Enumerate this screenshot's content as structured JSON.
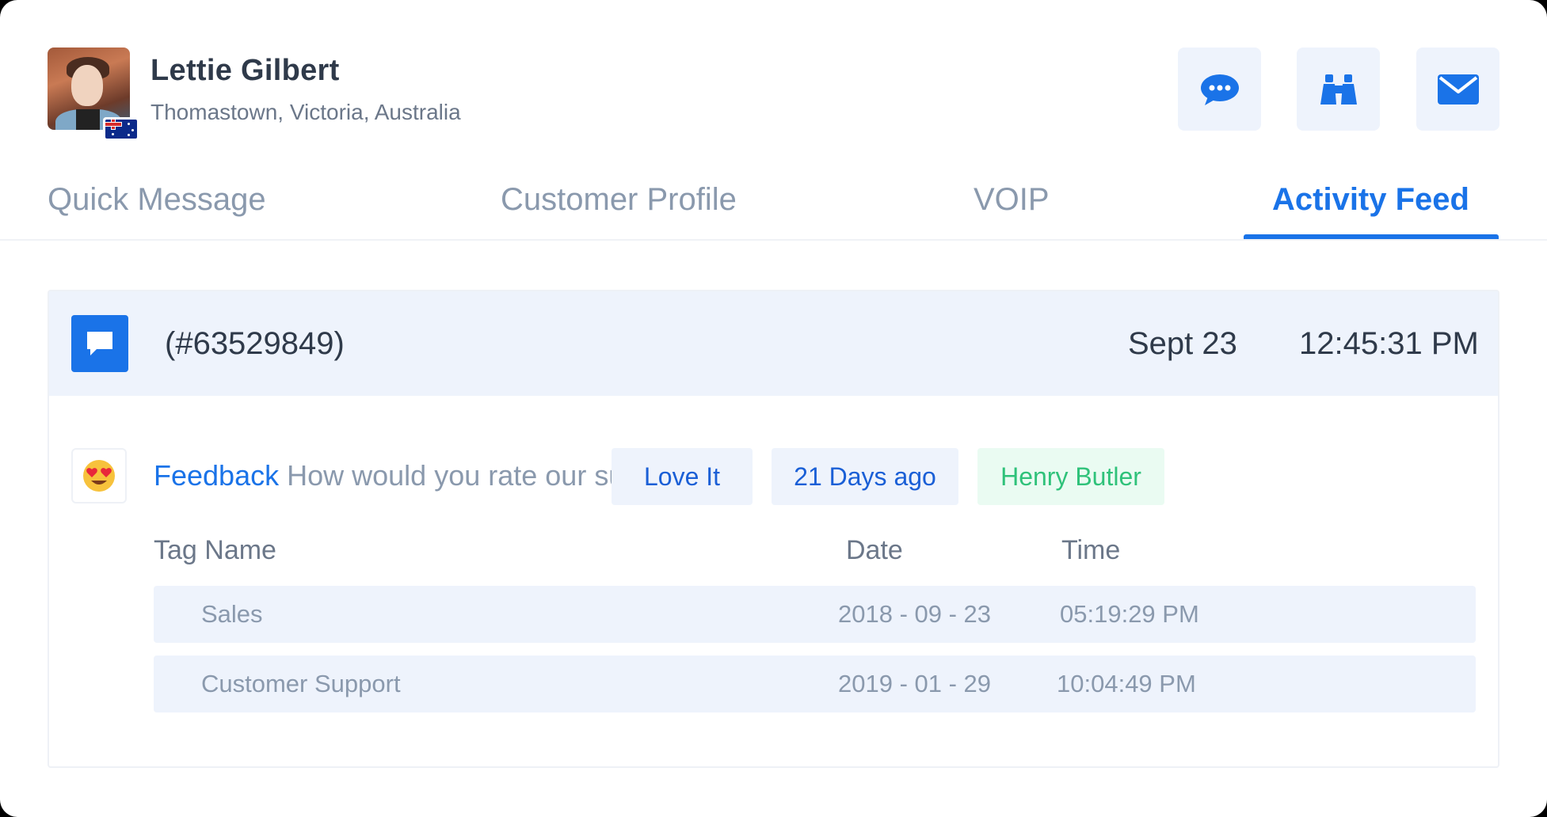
{
  "profile": {
    "name": "Lettie Gilbert",
    "location": "Thomastown, Victoria, Australia",
    "flag_icon": "australia-flag-icon"
  },
  "actions": [
    {
      "icon": "chat-icon",
      "label": "Chat"
    },
    {
      "icon": "binoculars-icon",
      "label": "Browse"
    },
    {
      "icon": "mail-icon",
      "label": "Email"
    }
  ],
  "tabs": [
    {
      "label": "Quick Message",
      "active": false
    },
    {
      "label": "Customer Profile",
      "active": false
    },
    {
      "label": "VOIP",
      "active": false
    },
    {
      "label": "Activity Feed",
      "active": true
    }
  ],
  "feed": {
    "ticket": "(#63529849)",
    "date": "Sept 23",
    "time": "12:45:31 PM",
    "feedback": {
      "emoji": "😍",
      "keyword": "Feedback",
      "question": "How would you rate our support?",
      "rating": "Love It",
      "age": "21 Days ago",
      "agent": "Henry Butler"
    },
    "columns": [
      "Tag Name",
      "Date",
      "Time"
    ],
    "rows": [
      {
        "tag": "Sales",
        "date": "2018 - 09 - 23",
        "time": "05:19:29 PM"
      },
      {
        "tag": "Customer Support",
        "date": "2019 - 01 - 29",
        "time": "10:04:49 PM"
      }
    ]
  },
  "colors": {
    "accent": "#1a73e8",
    "header_bg": "#eef3fc",
    "success": "#2fc27a"
  }
}
